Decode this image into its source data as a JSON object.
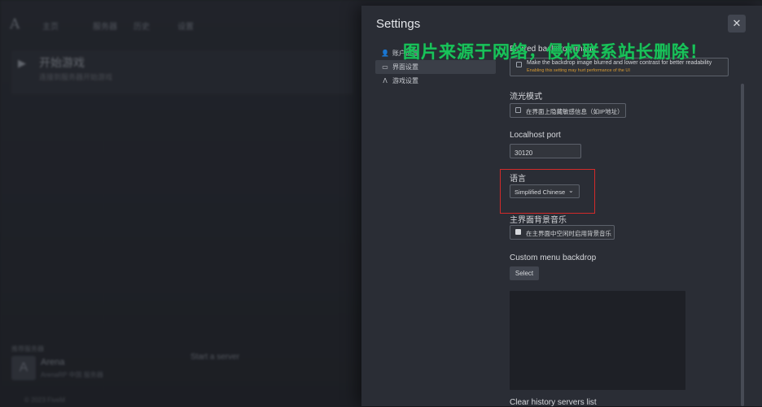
{
  "backdrop": {
    "logo": "A",
    "nav": [
      "主页",
      "服务器",
      "历史",
      "设置"
    ],
    "play_title": "开始游戏",
    "play_sub": "连接到服务器开始游戏",
    "section_label": "推荐服务器",
    "server_logo": "A",
    "server_name": "Arena",
    "server_sub": "ArenaRP 中国 服务器",
    "start_server": "Start a server",
    "footer": "© 2023 FiveM"
  },
  "settings": {
    "title": "Settings",
    "close_glyph": "✕",
    "sidebar": [
      {
        "icon": "user-icon",
        "glyph": "👤",
        "label": "账户设置",
        "active": false
      },
      {
        "icon": "monitor-icon",
        "glyph": "▭",
        "label": "界面设置",
        "active": true
      },
      {
        "icon": "game-icon",
        "glyph": "Λ",
        "label": "游戏设置",
        "active": false
      }
    ],
    "blurred_backdrop": {
      "title": "Blurred backdrop image",
      "label": "Make the backdrop image blurred and lower contrast for better readability",
      "warning": "Enabling this setting may hurt performance of the UI",
      "checked": false
    },
    "streamer_mode": {
      "title": "流光模式",
      "label": "在界面上隐藏敏感信息（如IP地址）",
      "checked": false
    },
    "localhost_port": {
      "title": "Localhost port",
      "value": "30120"
    },
    "language": {
      "title": "语言",
      "value": "Simplified Chinese",
      "chevron": "⌄"
    },
    "menu_music": {
      "title": "主界面背景音乐",
      "label": "在主界面中空闲时启用背景音乐",
      "checked": true
    },
    "custom_backdrop": {
      "title": "Custom menu backdrop",
      "button": "Select"
    },
    "clear_history": {
      "title": "Clear history servers list"
    }
  },
  "watermark": "图片来源于网络，侵权联系站长删除！",
  "colors": {
    "accent_highlight": "#d32a2a",
    "warning_text": "#d99b32",
    "watermark": "#19c25a"
  }
}
